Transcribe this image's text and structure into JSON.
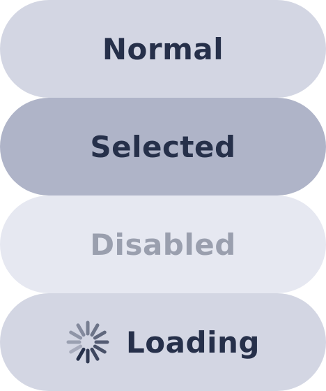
{
  "buttons": {
    "normal": {
      "label": "Normal",
      "state": "normal"
    },
    "selected": {
      "label": "Selected",
      "state": "selected"
    },
    "disabled": {
      "label": "Disabled",
      "state": "disabled"
    },
    "loading": {
      "label": "Loading",
      "state": "loading",
      "icon": "spinner-icon"
    }
  },
  "colors": {
    "normal_bg": "#d3d6e3",
    "selected_bg": "#afb4c8",
    "disabled_bg": "#e6e8f1",
    "text": "#26304a",
    "disabled_text": "#9a9fae",
    "spinner": "#26304a"
  }
}
